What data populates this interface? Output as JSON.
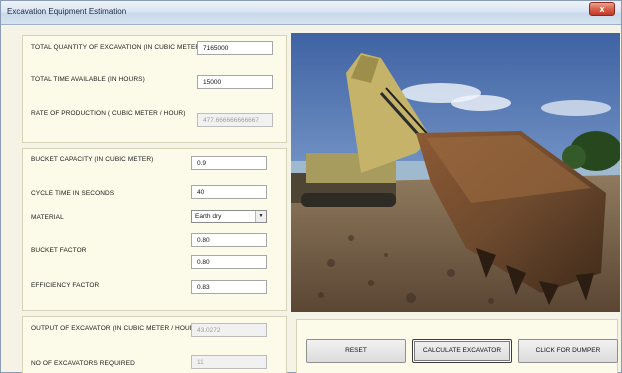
{
  "window": {
    "title": "Excavation Equipment Estimation",
    "close_glyph": "x"
  },
  "production": {
    "total_quantity_label": "TOTAL QUANTITY OF EXCAVATION  (IN CUBIC METER)",
    "total_quantity_value": "7165000",
    "total_time_label": "TOTAL TIME AVAILABLE (IN HOURS)",
    "total_time_value": "15000",
    "rate_label": "RATE OF PRODUCTION ( CUBIC METER / HOUR)",
    "rate_value": "477.666666666667"
  },
  "excavator": {
    "bucket_capacity_label": "BUCKET CAPACITY (IN CUBIC METER)",
    "bucket_capacity_value": "0.9",
    "cycle_time_label": "CYCLE TIME IN SECONDS",
    "cycle_time_value": "40",
    "material_label": "MATERIAL",
    "material_selected": "Earth dry",
    "bucket_factor_label": "BUCKET FACTOR",
    "bucket_factor_value_1": "0.80",
    "bucket_factor_value_2": "0.80",
    "efficiency_label": "EFFICIENCY FACTOR",
    "efficiency_value": "0.83"
  },
  "output": {
    "output_label": "OUTPUT OF EXCAVATOR (IN CUBIC METER / HOUR )",
    "output_value": "43.0272",
    "count_label": "NO OF EXCAVATORS REQUIRED",
    "count_value": "11"
  },
  "buttons": {
    "reset": "RESET",
    "calculate": "CALCULATE EXCAVATOR",
    "dumper": "CLICK FOR DUMPER"
  },
  "icons": {
    "close": "close-icon",
    "dropdown": "chevron-down-icon",
    "photo": "excavator-photo"
  },
  "colors": {
    "panel_bg": "#fcfae8",
    "window_bg": "#f4f3e6",
    "titlebar": "#dbe6f3",
    "close": "#c0392b"
  }
}
